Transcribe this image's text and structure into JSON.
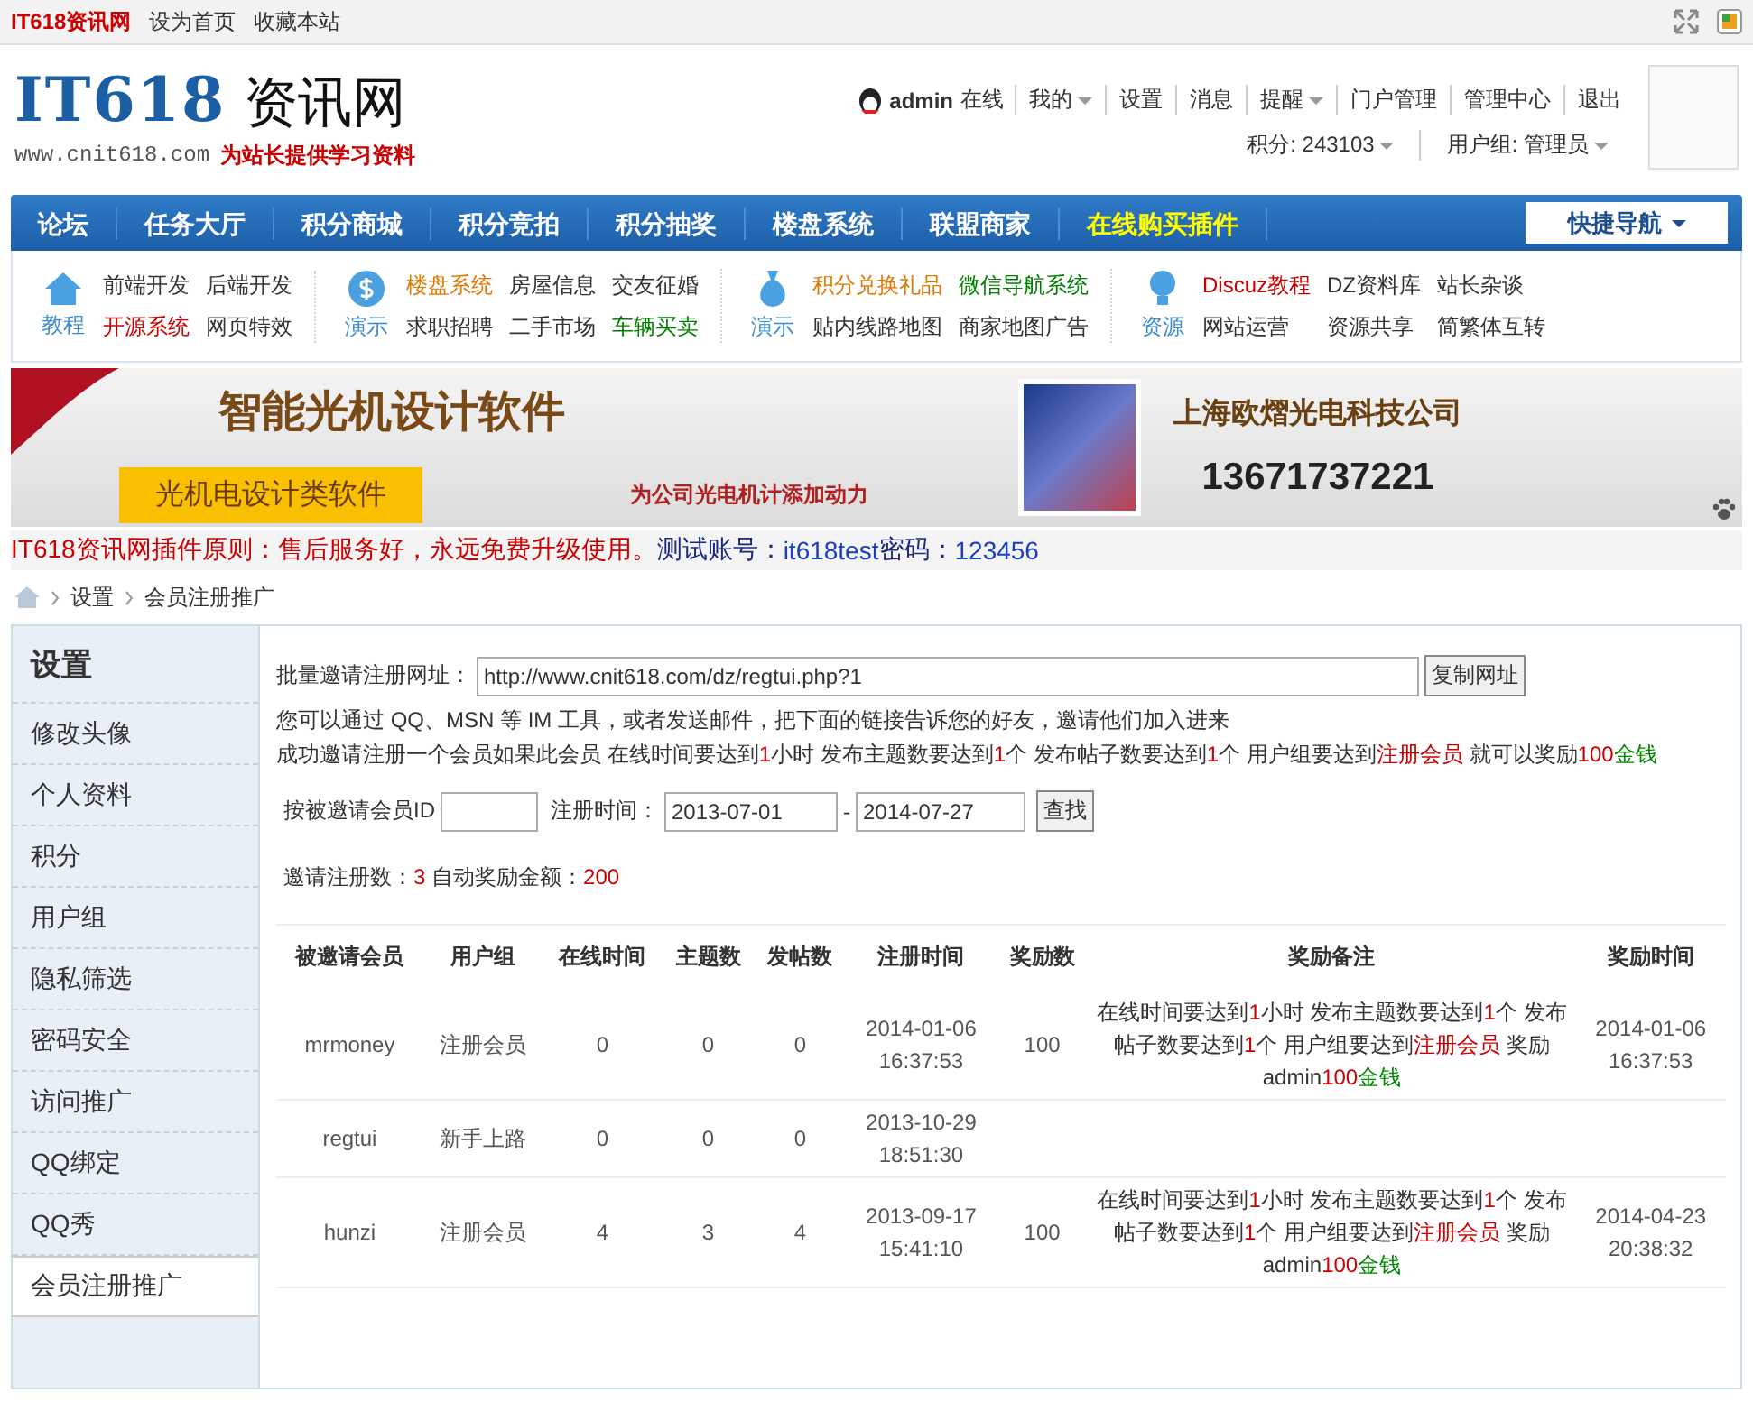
{
  "topbar": {
    "site": "IT618资讯网",
    "links": [
      "设为首页",
      "收藏本站"
    ]
  },
  "header": {
    "logo_main": "IT618",
    "logo_cn": "资讯网",
    "logo_url": "www.cnit618.com",
    "logo_slogan": "为站长提供学习资料",
    "user": "admin",
    "status": "在线",
    "user_links": [
      {
        "label": "我的",
        "dropdown": true
      },
      {
        "label": "设置",
        "dropdown": false
      },
      {
        "label": "消息",
        "dropdown": false
      },
      {
        "label": "提醒",
        "dropdown": true
      },
      {
        "label": "门户管理",
        "dropdown": false
      },
      {
        "label": "管理中心",
        "dropdown": false
      },
      {
        "label": "退出",
        "dropdown": false
      }
    ],
    "stats": [
      {
        "label": "积分: 243103",
        "dropdown": true
      },
      {
        "label": "用户组: 管理员",
        "dropdown": true
      }
    ]
  },
  "nav": {
    "items": [
      {
        "label": "论坛",
        "highlight": false
      },
      {
        "label": "任务大厅",
        "highlight": false
      },
      {
        "label": "积分商城",
        "highlight": false
      },
      {
        "label": "积分竞拍",
        "highlight": false
      },
      {
        "label": "积分抽奖",
        "highlight": false
      },
      {
        "label": "楼盘系统",
        "highlight": false
      },
      {
        "label": "联盟商家",
        "highlight": false
      },
      {
        "label": "在线购买插件",
        "highlight": true
      }
    ],
    "quick": "快捷导航"
  },
  "categories": [
    {
      "title": "教程",
      "links": [
        {
          "label": "前端开发",
          "color": "#333333"
        },
        {
          "label": "后端开发",
          "color": "#333333"
        },
        {
          "label": "开源系统",
          "color": "#cc0000"
        },
        {
          "label": "网页特效",
          "color": "#333333"
        }
      ]
    },
    {
      "title": "演示",
      "links": [
        {
          "label": "楼盘系统",
          "color": "#e07800"
        },
        {
          "label": "房屋信息",
          "color": "#333333"
        },
        {
          "label": "交友征婚",
          "color": "#333333"
        },
        {
          "label": "求职招聘",
          "color": "#333333"
        },
        {
          "label": "二手市场",
          "color": "#333333"
        },
        {
          "label": "车辆买卖",
          "color": "#008000"
        }
      ]
    },
    {
      "title": "演示",
      "links": [
        {
          "label": "积分兑换礼品",
          "color": "#e07800"
        },
        {
          "label": "微信导航系统",
          "color": "#008000"
        },
        {
          "label": "贴内线路地图",
          "color": "#333333"
        },
        {
          "label": "商家地图广告",
          "color": "#333333"
        }
      ]
    },
    {
      "title": "资源",
      "links": [
        {
          "label": "Discuz教程",
          "color": "#cc0000"
        },
        {
          "label": "DZ资料库",
          "color": "#333333"
        },
        {
          "label": "站长杂谈",
          "color": "#333333"
        },
        {
          "label": "网站运营",
          "color": "#333333"
        },
        {
          "label": "资源共享",
          "color": "#333333"
        },
        {
          "label": "简繁体互转",
          "color": "#333333"
        }
      ]
    }
  ],
  "banner": {
    "headline": "智能光机设计软件",
    "tag": "光机电设计类软件",
    "sub": "为公司光电机计添加动力",
    "company": "上海欧熠光电科技公司",
    "phone": "13671737221"
  },
  "notice": [
    {
      "text": "IT618资讯网插件原则：售后服务好，永远免费升级使用。",
      "kind": "red"
    },
    {
      "text": "测试账号：",
      "kind": "navy"
    },
    {
      "text": "it618test",
      "kind": "blue"
    },
    {
      "text": " 密码：",
      "kind": "navy"
    },
    {
      "text": "123456",
      "kind": "blue"
    }
  ],
  "breadcrumb": [
    "设置",
    "会员注册推广"
  ],
  "sidebar": {
    "title": "设置",
    "items": [
      {
        "label": "修改头像",
        "selected": false
      },
      {
        "label": "个人资料",
        "selected": false
      },
      {
        "label": "积分",
        "selected": false
      },
      {
        "label": "用户组",
        "selected": false
      },
      {
        "label": "隐私筛选",
        "selected": false
      },
      {
        "label": "密码安全",
        "selected": false
      },
      {
        "label": "访问推广",
        "selected": false
      },
      {
        "label": "QQ绑定",
        "selected": false
      },
      {
        "label": "QQ秀",
        "selected": false
      },
      {
        "label": "会员注册推广",
        "selected": true
      }
    ]
  },
  "invite": {
    "label": "批量邀请注册网址：",
    "url": "http://www.cnit618.com/dz/regtui.php?1",
    "button": "复制网址",
    "hint": "您可以通过 QQ、MSN 等 IM 工具，或者发送邮件，把下面的链接告诉您的好友，邀请他们加入进来",
    "rule": [
      {
        "text": "成功邀请注册一个会员如果此会员 在线时间要达到",
        "kind": "plain"
      },
      {
        "text": "1",
        "kind": "value"
      },
      {
        "text": "小时 发布主题数要达到",
        "kind": "plain"
      },
      {
        "text": "1",
        "kind": "value"
      },
      {
        "text": "个 发布帖子数要达到",
        "kind": "plain"
      },
      {
        "text": "1",
        "kind": "value"
      },
      {
        "text": "个 用户组要达到",
        "kind": "plain"
      },
      {
        "text": "注册会员",
        "kind": "value"
      },
      {
        "text": " 就可以奖励",
        "kind": "plain"
      },
      {
        "text": "100",
        "kind": "value"
      },
      {
        "text": "金钱",
        "kind": "money"
      }
    ]
  },
  "search": {
    "id_label": "按被邀请会员ID",
    "time_label": "注册时间：",
    "from": "2013-07-01",
    "sep": "-",
    "to": "2014-07-27",
    "button": "查找"
  },
  "summary": [
    {
      "text": "邀请注册数：",
      "kind": "plain"
    },
    {
      "text": "3",
      "kind": "value"
    },
    {
      "text": " 自动奖励金额：",
      "kind": "plain"
    },
    {
      "text": "200",
      "kind": "value"
    }
  ],
  "table": {
    "columns": [
      "被邀请会员",
      "用户组",
      "在线时间",
      "主题数",
      "发帖数",
      "注册时间",
      "奖励数",
      "奖励备注",
      "奖励时间"
    ],
    "rows": [
      {
        "member": "mrmoney",
        "group": "注册会员",
        "online": "0",
        "topics": "0",
        "posts": "0",
        "reg_date": "2014-01-06",
        "reg_time": "16:37:53",
        "reward": "100",
        "note": [
          {
            "text": "在线时间要达到",
            "kind": "plain"
          },
          {
            "text": "1",
            "kind": "value"
          },
          {
            "text": "小时 发布主题数要达到",
            "kind": "plain"
          },
          {
            "text": "1",
            "kind": "value"
          },
          {
            "text": "个 发布帖子数要达到",
            "kind": "plain"
          },
          {
            "text": "1",
            "kind": "value"
          },
          {
            "text": "个 用户组要达到",
            "kind": "plain"
          },
          {
            "text": "注册会员",
            "kind": "value"
          },
          {
            "text": " 奖励 admin",
            "kind": "plain"
          },
          {
            "text": "100",
            "kind": "value"
          },
          {
            "text": "金钱",
            "kind": "money"
          }
        ],
        "reward_date": "2014-01-06",
        "reward_time": "16:37:53"
      },
      {
        "member": "regtui",
        "group": "新手上路",
        "online": "0",
        "topics": "0",
        "posts": "0",
        "reg_date": "2013-10-29",
        "reg_time": "18:51:30"
      },
      {
        "member": "hunzi",
        "group": "注册会员",
        "online": "4",
        "topics": "3",
        "posts": "4",
        "reg_date": "2013-09-17",
        "reg_time": "15:41:10",
        "reward": "100",
        "note": [
          {
            "text": "在线时间要达到",
            "kind": "plain"
          },
          {
            "text": "1",
            "kind": "value"
          },
          {
            "text": "小时 发布主题数要达到",
            "kind": "plain"
          },
          {
            "text": "1",
            "kind": "value"
          },
          {
            "text": "个 发布帖子数要达到",
            "kind": "plain"
          },
          {
            "text": "1",
            "kind": "value"
          },
          {
            "text": "个 用户组要达到",
            "kind": "plain"
          },
          {
            "text": "注册会员",
            "kind": "value"
          },
          {
            "text": " 奖励 admin",
            "kind": "plain"
          },
          {
            "text": "100",
            "kind": "value"
          },
          {
            "text": "金钱",
            "kind": "money"
          }
        ],
        "reward_date": "2014-04-23",
        "reward_time": "20:38:32"
      }
    ]
  }
}
